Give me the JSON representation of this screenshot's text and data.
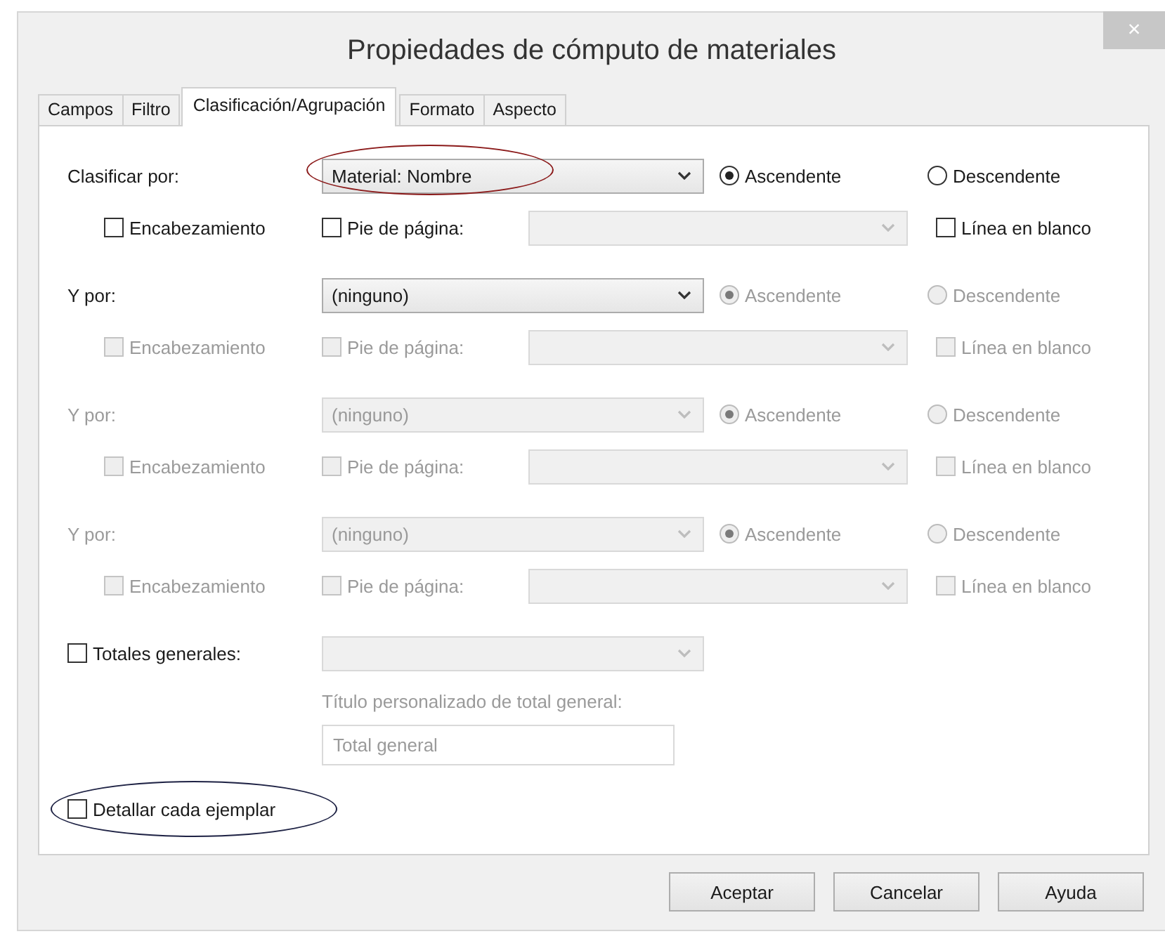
{
  "window": {
    "title": "Propiedades de cómputo de materiales",
    "close": "×"
  },
  "tabs": [
    {
      "label": "Campos",
      "selected": false
    },
    {
      "label": "Filtro",
      "selected": false
    },
    {
      "label": "Clasificación/Agrupación",
      "selected": true
    },
    {
      "label": "Formato",
      "selected": false
    },
    {
      "label": "Aspecto",
      "selected": false
    }
  ],
  "sort_levels": [
    {
      "label": {
        "text": "Clasificar por:",
        "disabled": false
      },
      "field": {
        "value": "Material: Nombre",
        "disabled": false
      },
      "order": [
        {
          "label": "Ascendente",
          "selected": true,
          "disabled": false
        },
        {
          "label": "Descendente",
          "selected": false,
          "disabled": false
        }
      ],
      "options": [
        {
          "label": "Encabezamiento",
          "checked": false,
          "disabled": false
        },
        {
          "label": "Pie de página:",
          "checked": false,
          "disabled": false
        },
        {
          "label": "Línea en blanco",
          "checked": false,
          "disabled": false
        }
      ],
      "footer_field": {
        "disabled": true
      }
    },
    {
      "label": {
        "text": "Y por:",
        "disabled": false
      },
      "field": {
        "value": "(ninguno)",
        "disabled": false
      },
      "order": [
        {
          "label": "Ascendente",
          "selected": true,
          "disabled": true
        },
        {
          "label": "Descendente",
          "selected": false,
          "disabled": true
        }
      ],
      "options": [
        {
          "label": "Encabezamiento",
          "checked": false,
          "disabled": true
        },
        {
          "label": "Pie de página:",
          "checked": false,
          "disabled": true
        },
        {
          "label": "Línea en blanco",
          "checked": false,
          "disabled": true
        }
      ],
      "footer_field": {
        "disabled": true
      }
    },
    {
      "label": {
        "text": "Y por:",
        "disabled": true
      },
      "field": {
        "value": "(ninguno)",
        "disabled": true
      },
      "order": [
        {
          "label": "Ascendente",
          "selected": true,
          "disabled": true
        },
        {
          "label": "Descendente",
          "selected": false,
          "disabled": true
        }
      ],
      "options": [
        {
          "label": "Encabezamiento",
          "checked": false,
          "disabled": true
        },
        {
          "label": "Pie de página:",
          "checked": false,
          "disabled": true
        },
        {
          "label": "Línea en blanco",
          "checked": false,
          "disabled": true
        }
      ],
      "footer_field": {
        "disabled": true
      }
    },
    {
      "label": {
        "text": "Y por:",
        "disabled": true
      },
      "field": {
        "value": "(ninguno)",
        "disabled": true
      },
      "order": [
        {
          "label": "Ascendente",
          "selected": true,
          "disabled": true
        },
        {
          "label": "Descendente",
          "selected": false,
          "disabled": true
        }
      ],
      "options": [
        {
          "label": "Encabezamiento",
          "checked": false,
          "disabled": true
        },
        {
          "label": "Pie de página:",
          "checked": false,
          "disabled": true
        },
        {
          "label": "Línea en blanco",
          "checked": false,
          "disabled": true
        }
      ],
      "footer_field": {
        "disabled": true
      }
    }
  ],
  "grand_totals": {
    "label": "Totales generales:",
    "checked": false,
    "disabled": false,
    "field": {
      "disabled": true
    },
    "title_label": {
      "text": "Título personalizado de total general:",
      "disabled": true
    },
    "title_field": {
      "value": "Total general",
      "disabled": true
    }
  },
  "itemize": {
    "label": "Detallar cada ejemplar",
    "checked": false,
    "disabled": false
  },
  "buttons": [
    "Aceptar",
    "Cancelar",
    "Ayuda"
  ]
}
